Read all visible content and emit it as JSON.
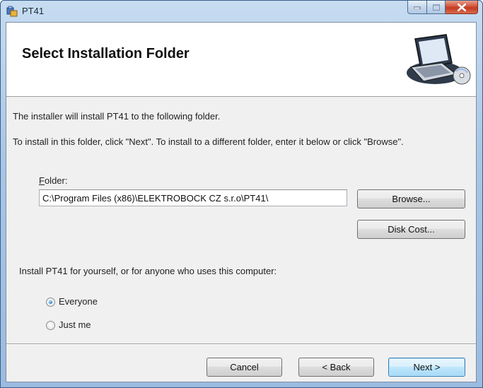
{
  "window": {
    "title": "PT41",
    "controls": [
      "minimize-icon",
      "maximize-icon",
      "close-icon"
    ]
  },
  "banner": {
    "title": "Select Installation Folder",
    "art_icon": "computer-disc-icon"
  },
  "intro": {
    "line1": "The installer will install PT41 to the following folder.",
    "line2": "To install in this folder, click \"Next\". To install to a different folder, enter it below or click \"Browse\"."
  },
  "folder": {
    "label_accel": "F",
    "label_rest": "older:",
    "value": "C:\\Program Files (x86)\\ELEKTROBOCK CZ s.r.o\\PT41\\"
  },
  "buttons": {
    "browse": "Browse...",
    "disk_cost": "Disk Cost...",
    "cancel": "Cancel",
    "back": "< Back",
    "next": "Next >"
  },
  "scope": {
    "prompt": "Install PT41 for yourself, or for anyone who uses this computer:",
    "options": [
      {
        "label": "Everyone",
        "selected": true
      },
      {
        "label": "Just me",
        "selected": false
      }
    ]
  },
  "colors": {
    "default_button_border": "#3c7fb1",
    "radio_selected": "#2a8bd6"
  }
}
